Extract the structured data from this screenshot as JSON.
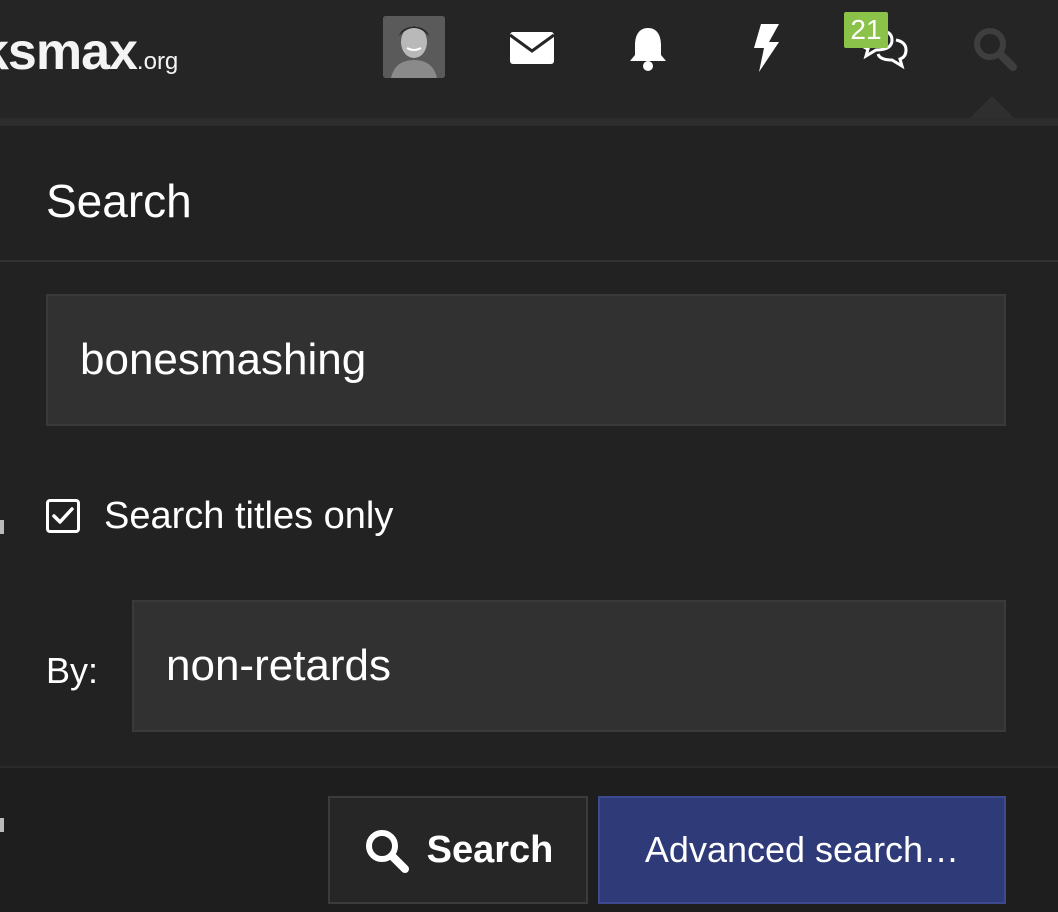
{
  "header": {
    "logo_main": "ksmax",
    "logo_tld": ".org",
    "icons": {
      "avatar": "user-avatar",
      "inbox": "envelope-icon",
      "alerts": "bell-icon",
      "whats_new": "bolt-icon",
      "conversations": "chat-bubbles-icon",
      "search": "magnifier-icon"
    },
    "conversations_badge": "21"
  },
  "search_panel": {
    "title": "Search",
    "query_value": "bonesmashing",
    "titles_only_label": "Search titles only",
    "titles_only_checked": true,
    "by_label": "By:",
    "by_value": "non-retards",
    "search_button_label": "Search",
    "advanced_button_label": "Advanced search…"
  },
  "colors": {
    "background": "#222222",
    "header_bg": "#252525",
    "input_bg": "#313131",
    "badge": "#8bc34a",
    "primary_button": "#2f3b78"
  }
}
